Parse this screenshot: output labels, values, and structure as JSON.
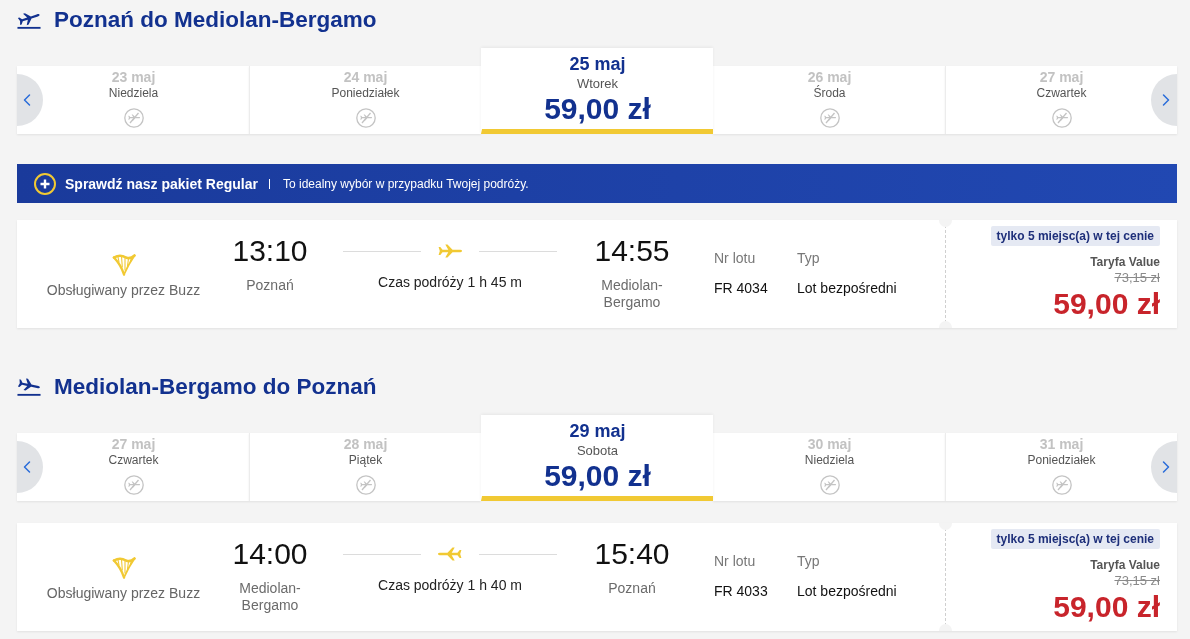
{
  "sections": [
    {
      "kind": "outbound",
      "title": "Poznań do Mediolan-Bergamo",
      "dates": [
        {
          "date": "23 maj",
          "day": "Niedziela",
          "selected": false
        },
        {
          "date": "24 maj",
          "day": "Poniedziałek",
          "selected": false
        },
        {
          "date": "25 maj",
          "day": "Wtorek",
          "price": "59,00 zł",
          "selected": true
        },
        {
          "date": "26 maj",
          "day": "Środa",
          "selected": false
        },
        {
          "date": "27 maj",
          "day": "Czwartek",
          "selected": false
        }
      ],
      "promo": {
        "title": "Sprawdź nasz pakiet Regular",
        "text": "To idealny wybór w przypadku Twojej podróży."
      },
      "flight": {
        "operator": "Obsługiwany przez Buzz",
        "departure_time": "13:10",
        "departure_city": "Poznań",
        "duration": "Czas podróży 1 h 45 m",
        "arrival_time": "14:55",
        "arrival_city": "Mediolan-Bergamo",
        "flight_no_label": "Nr lotu",
        "flight_no": "FR 4034",
        "type_label": "Typ",
        "type": "Lot bezpośredni",
        "availability": "tylko 5 miejsc(a) w tej cenie",
        "fare": "Taryfa Value",
        "old_price": "73,15 zł",
        "price": "59,00 zł"
      }
    },
    {
      "kind": "return",
      "title": "Mediolan-Bergamo do Poznań",
      "dates": [
        {
          "date": "27 maj",
          "day": "Czwartek",
          "selected": false
        },
        {
          "date": "28 maj",
          "day": "Piątek",
          "selected": false
        },
        {
          "date": "29 maj",
          "day": "Sobota",
          "price": "59,00 zł",
          "selected": true
        },
        {
          "date": "30 maj",
          "day": "Niedziela",
          "selected": false
        },
        {
          "date": "31 maj",
          "day": "Poniedziałek",
          "selected": false
        }
      ],
      "flight": {
        "operator": "Obsługiwany przez Buzz",
        "departure_time": "14:00",
        "departure_city": "Mediolan-Bergamo",
        "duration": "Czas podróży 1 h 40 m",
        "arrival_time": "15:40",
        "arrival_city": "Poznań",
        "flight_no_label": "Nr lotu",
        "flight_no": "FR 4033",
        "type_label": "Typ",
        "type": "Lot bezpośredni",
        "availability": "tylko 5 miejsc(a) w tej cenie",
        "fare": "Taryfa Value",
        "old_price": "73,15 zł",
        "price": "59,00 zł"
      }
    }
  ]
}
